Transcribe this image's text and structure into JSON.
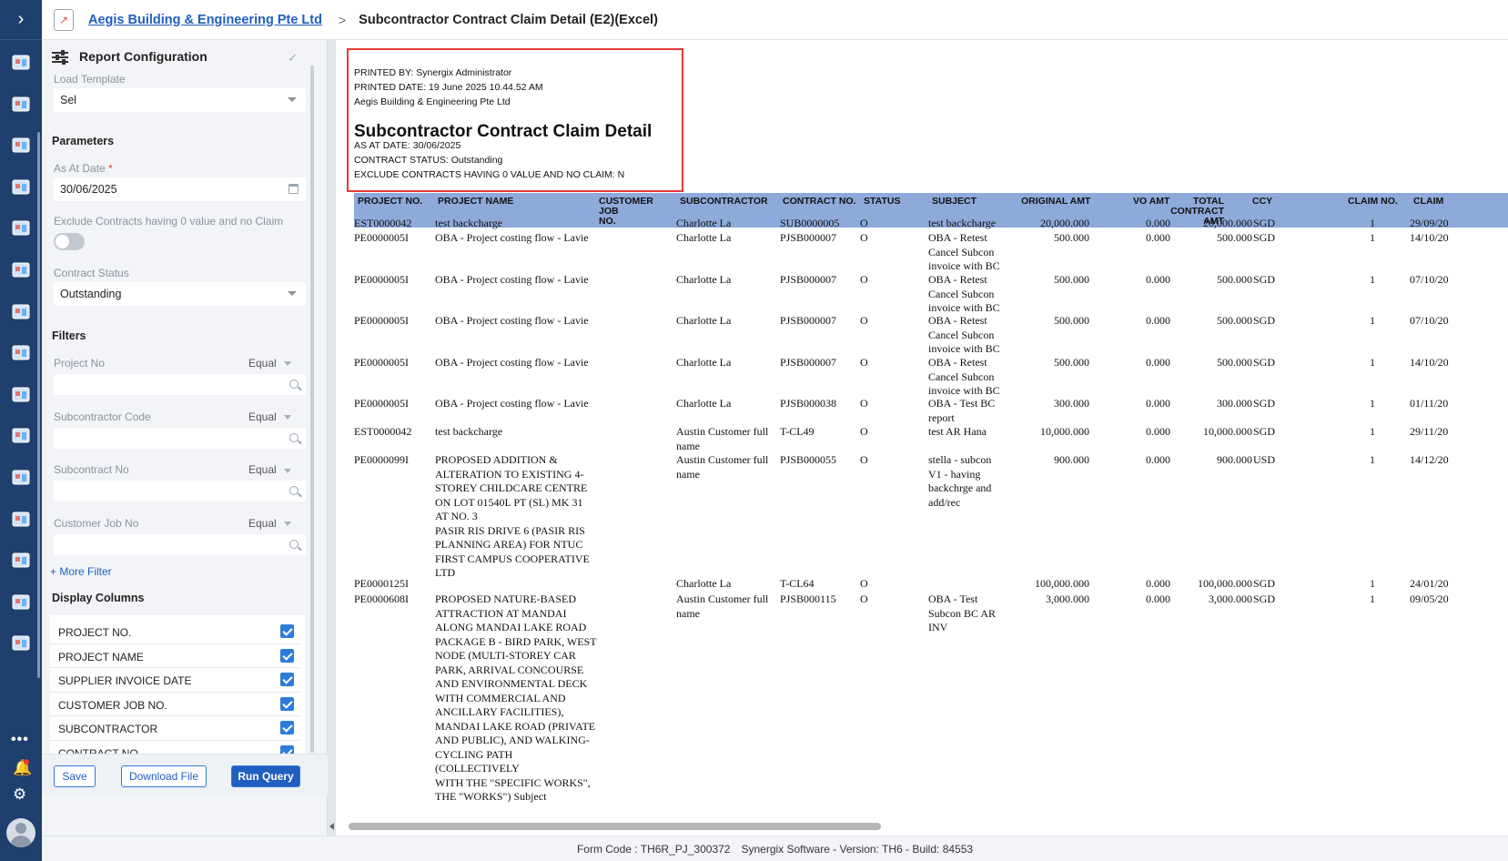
{
  "header": {
    "company": "Aegis Building & Engineering Pte Ltd",
    "separator": ">",
    "title": "Subcontractor Contract Claim Detail (E2)(Excel)"
  },
  "rail": {
    "icons": [
      "dashboard-icon",
      "network-icon",
      "store-icon",
      "book-icon",
      "document-icon",
      "cart-icon",
      "contact-icon",
      "tools-icon",
      "chart-icon",
      "building-icon",
      "people-icon",
      "money-icon",
      "home-icon",
      "truck-icon",
      "invoice-icon"
    ],
    "more": "•••"
  },
  "config": {
    "title": "Report Configuration",
    "load_template_label": "Load Template",
    "load_template_value": "Sel",
    "parameters_heading": "Parameters",
    "as_at_date_label": "As At Date",
    "required_mark": "*",
    "as_at_date_value": "30/06/2025",
    "exclude_label": "Exclude Contracts having 0 value and no Claim",
    "contract_status_label": "Contract Status",
    "contract_status_value": "Outstanding",
    "filters_heading": "Filters",
    "filters": [
      {
        "label": "Project No",
        "op": "Equal"
      },
      {
        "label": "Subcontractor Code",
        "op": "Equal"
      },
      {
        "label": "Subcontract No",
        "op": "Equal"
      },
      {
        "label": "Customer Job No",
        "op": "Equal"
      }
    ],
    "more_filter": "+ More Filter",
    "display_columns_heading": "Display Columns",
    "columns": [
      "PROJECT NO.",
      "PROJECT NAME",
      "SUPPLIER INVOICE DATE",
      "CUSTOMER JOB NO.",
      "SUBCONTRACTOR",
      "CONTRACT NO."
    ],
    "buttons": {
      "save": "Save",
      "download": "Download File",
      "run": "Run Query"
    }
  },
  "report": {
    "printed_by": "PRINTED BY: Synergix Administrator",
    "printed_date": "PRINTED DATE: 19 June 2025 10.44.52 AM",
    "company": "Aegis Building & Engineering Pte Ltd",
    "title": "Subcontractor Contract Claim Detail",
    "as_at": "AS AT DATE: 30/06/2025",
    "contract_status": "CONTRACT STATUS: Outstanding",
    "exclude": "EXCLUDE CONTRACTS HAVING 0 VALUE AND NO CLAIM: N",
    "columns": [
      "PROJECT NO.",
      "PROJECT NAME",
      "CUSTOMER\nJOB\nNO.",
      "SUBCONTRACTOR",
      "CONTRACT NO.",
      "STATUS",
      "SUBJECT",
      "ORIGINAL AMT",
      "VO AMT",
      "TOTAL\nCONTRACT\nAMT",
      "CCY",
      "CLAIM NO.",
      "CLAIM"
    ],
    "rows": [
      {
        "project_no": "EST0000042",
        "project_name": "test backcharge",
        "job": "",
        "subcontractor": "Charlotte La",
        "contract_no": "SUB0000005",
        "status": "O",
        "subject": "test backcharge",
        "original": "20,000.000",
        "vo": "0.000",
        "total": "20,000.000",
        "ccy": "SGD",
        "claim_no": "1",
        "claim": "29/09/20"
      },
      {
        "project_no": "PE0000005I",
        "project_name": "OBA - Project costing flow - Lavie",
        "job": "",
        "subcontractor": "Charlotte La",
        "contract_no": "PJSB000007",
        "status": "O",
        "subject": "OBA - Retest\nCancel Subcon\ninvoice with BC",
        "original": "500.000",
        "vo": "0.000",
        "total": "500.000",
        "ccy": "SGD",
        "claim_no": "1",
        "claim": "14/10/20"
      },
      {
        "project_no": "PE0000005I",
        "project_name": "OBA - Project costing flow - Lavie",
        "job": "",
        "subcontractor": "Charlotte La",
        "contract_no": "PJSB000007",
        "status": "O",
        "subject": "OBA - Retest\nCancel Subcon\ninvoice with BC",
        "original": "500.000",
        "vo": "0.000",
        "total": "500.000",
        "ccy": "SGD",
        "claim_no": "1",
        "claim": "07/10/20"
      },
      {
        "project_no": "PE0000005I",
        "project_name": "OBA - Project costing flow - Lavie",
        "job": "",
        "subcontractor": "Charlotte La",
        "contract_no": "PJSB000007",
        "status": "O",
        "subject": "OBA - Retest\nCancel Subcon\ninvoice with BC",
        "original": "500.000",
        "vo": "0.000",
        "total": "500.000",
        "ccy": "SGD",
        "claim_no": "1",
        "claim": "07/10/20"
      },
      {
        "project_no": "PE0000005I",
        "project_name": "OBA - Project costing flow - Lavie",
        "job": "",
        "subcontractor": "Charlotte La",
        "contract_no": "PJSB000007",
        "status": "O",
        "subject": "OBA - Retest\nCancel Subcon\ninvoice with BC",
        "original": "500.000",
        "vo": "0.000",
        "total": "500.000",
        "ccy": "SGD",
        "claim_no": "1",
        "claim": "14/10/20"
      },
      {
        "project_no": "PE0000005I",
        "project_name": "OBA - Project costing flow - Lavie",
        "job": "",
        "subcontractor": "Charlotte La",
        "contract_no": "PJSB000038",
        "status": "O",
        "subject": "OBA - Test BC\nreport",
        "original": "300.000",
        "vo": "0.000",
        "total": "300.000",
        "ccy": "SGD",
        "claim_no": "1",
        "claim": "01/11/20"
      },
      {
        "project_no": "EST0000042",
        "project_name": "test backcharge",
        "job": "",
        "subcontractor": "Austin Customer full\nname",
        "contract_no": "T-CL49",
        "status": "O",
        "subject": "test AR Hana",
        "original": "10,000.000",
        "vo": "0.000",
        "total": "10,000.000",
        "ccy": "SGD",
        "claim_no": "1",
        "claim": "29/11/20"
      },
      {
        "project_no": "PE0000099I",
        "project_name": "PROPOSED ADDITION &\nALTERATION TO EXISTING 4-\nSTOREY CHILDCARE CENTRE\nON LOT 01540L PT (SL) MK 31\nAT NO. 3\nPASIR RIS DRIVE 6 (PASIR RIS\nPLANNING AREA) FOR NTUC\nFIRST CAMPUS COOPERATIVE\nLTD",
        "job": "",
        "subcontractor": "Austin Customer full\nname",
        "contract_no": "PJSB000055",
        "status": "O",
        "subject": "stella - subcon\nV1 - having\nbackchrge and\nadd/rec",
        "original": "900.000",
        "vo": "0.000",
        "total": "900.000",
        "ccy": "USD",
        "claim_no": "1",
        "claim": "14/12/20"
      },
      {
        "project_no": "PE0000125I",
        "project_name": "",
        "job": "",
        "subcontractor": "Charlotte La",
        "contract_no": "T-CL64",
        "status": "O",
        "subject": "",
        "original": "100,000.000",
        "vo": "0.000",
        "total": "100,000.000",
        "ccy": "SGD",
        "claim_no": "1",
        "claim": "24/01/20"
      },
      {
        "project_no": "PE0000608I",
        "project_name": "PROPOSED NATURE-BASED\nATTRACTION AT MANDAI\nALONG MANDAI LAKE ROAD\nPACKAGE B - BIRD PARK, WEST\nNODE (MULTI-STOREY CAR\nPARK, ARRIVAL CONCOURSE\nAND ENVIRONMENTAL DECK\nWITH COMMERCIAL AND\nANCILLARY FACILITIES),\nMANDAI LAKE ROAD (PRIVATE\nAND PUBLIC), AND WALKING-\nCYCLING PATH (COLLECTIVELY\nWITH THE \"SPECIFIC WORKS\",\nTHE \"WORKS\") Subject",
        "job": "",
        "subcontractor": "Austin Customer full\nname",
        "contract_no": "PJSB000115",
        "status": "O",
        "subject": "OBA - Test\nSubcon BC AR\nINV",
        "original": "3,000.000",
        "vo": "0.000",
        "total": "3,000.000",
        "ccy": "SGD",
        "claim_no": "1",
        "claim": "09/05/20"
      }
    ]
  },
  "footer": {
    "form_code": "Form Code : TH6R_PJ_300372",
    "version": "Synergix Software - Version: TH6 - Build: 84553"
  }
}
